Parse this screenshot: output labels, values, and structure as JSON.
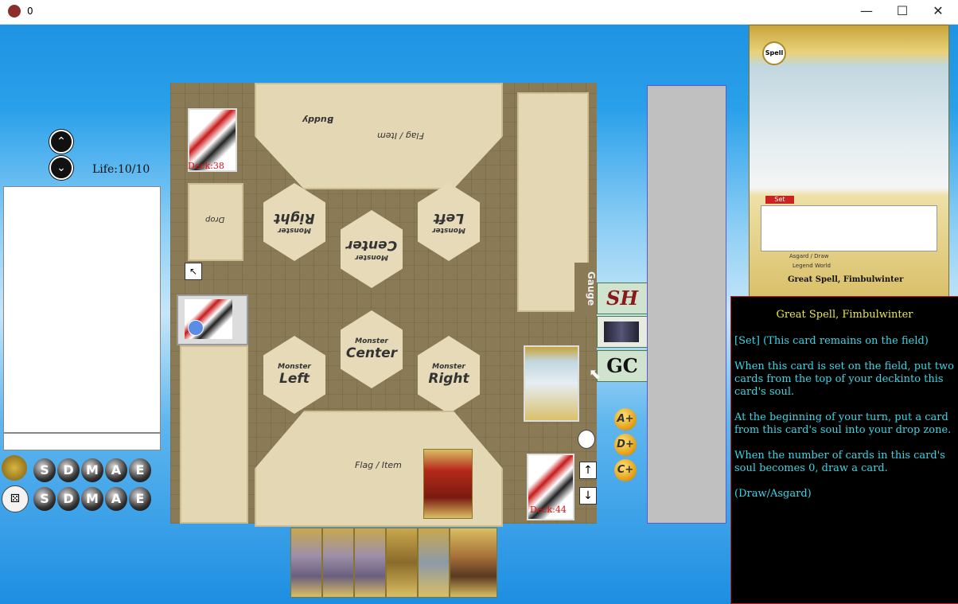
{
  "window": {
    "title": "0",
    "minimize": "—",
    "maximize": "☐",
    "close": "✕"
  },
  "left": {
    "up": "⌃",
    "down": "⌄",
    "life": "Life:10/10",
    "sdmae_row1": [
      "S",
      "D",
      "M",
      "A",
      "E"
    ],
    "sdmae_row2": [
      "S",
      "D",
      "M",
      "A",
      "E"
    ]
  },
  "field": {
    "opp_buddy": "Buddy",
    "opp_flag": "Flag / Item",
    "opp_right": "Right",
    "opp_center": "Center",
    "opp_left": "Left",
    "monster": "Monster",
    "drop": "Drop",
    "opp_deck": "Deck:38",
    "gauge": "Gauge",
    "my_left": "Left",
    "my_center": "Center",
    "my_right": "Right",
    "my_flag": "Flag / Item",
    "my_deck": "Deck:44"
  },
  "side": {
    "sh": "SH",
    "gc": "GC",
    "orbs": [
      "A+",
      "D+",
      "C+"
    ],
    "up": "↑",
    "down": "↓"
  },
  "card_preview": {
    "type_badge": "Spell",
    "set_label": "Set",
    "attr": "Asgard / Draw",
    "world": "Legend World",
    "name": "Great Spell, Fimbulwinter"
  },
  "info": {
    "card_name": "Great Spell, Fimbulwinter",
    "lines": [
      "[Set] (This card remains on the field)",
      "When this card is set on the field, put two cards from the top of your deckinto this card's soul.",
      "At the beginning of your turn, put a card from this card's soul into your drop zone.",
      "When the number of cards in this card's soul becomes 0, draw a card.",
      "(Draw/Asgard)"
    ]
  }
}
